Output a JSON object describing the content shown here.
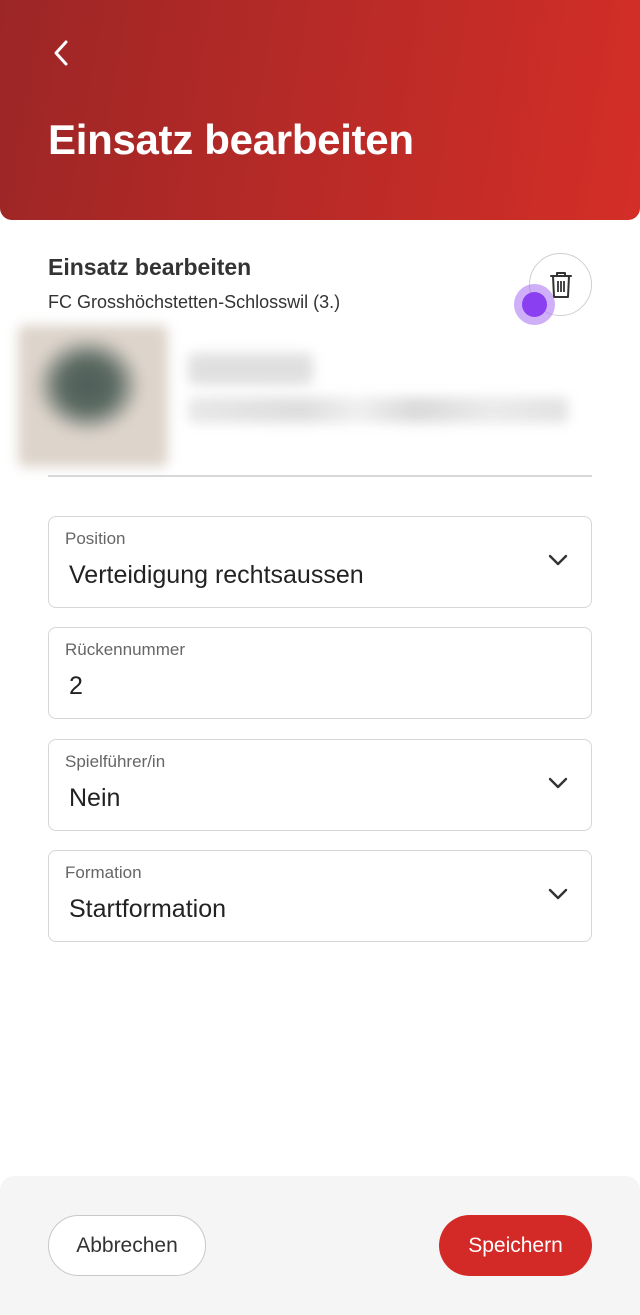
{
  "header": {
    "title": "Einsatz bearbeiten",
    "back_icon": "chevron-left-icon"
  },
  "section": {
    "title": "Einsatz bearbeiten",
    "subtitle": "FC Grosshöchstetten-Schlosswil (3.)",
    "delete_icon": "trash-icon"
  },
  "fields": {
    "position": {
      "label": "Position",
      "value": "Verteidigung rechtsaussen"
    },
    "number": {
      "label": "Rückennummer",
      "value": "2"
    },
    "captain": {
      "label": "Spielführer/in",
      "value": "Nein"
    },
    "formation": {
      "label": "Formation",
      "value": "Startformation"
    }
  },
  "footer": {
    "cancel_label": "Abbrechen",
    "save_label": "Speichern"
  },
  "colors": {
    "header_gradient_start": "#9c2626",
    "header_gradient_end": "#d42e27",
    "primary_button": "#d42a27",
    "touch_indicator": "#8a3ff0"
  }
}
